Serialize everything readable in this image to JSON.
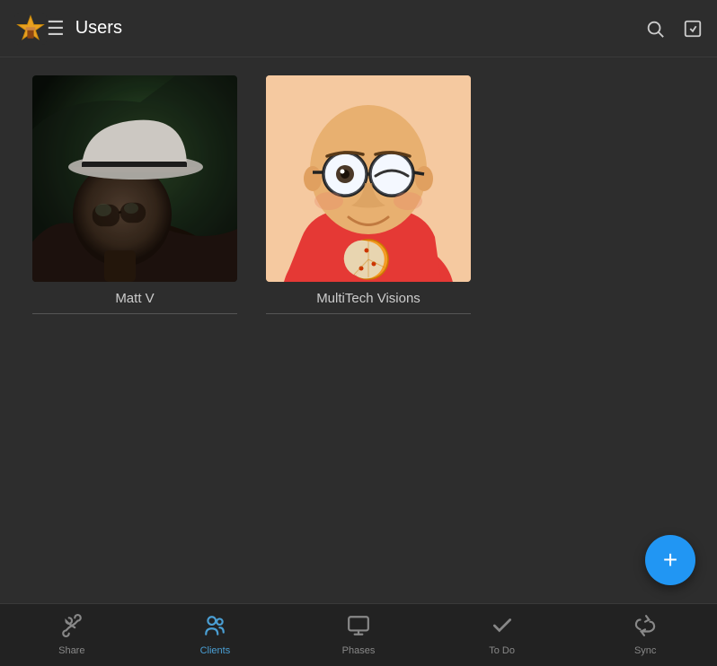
{
  "header": {
    "title": "Users",
    "menu_icon": "☰",
    "search_label": "search",
    "check_label": "check"
  },
  "users": [
    {
      "id": "matt-v",
      "name": "Matt V",
      "avatar_type": "photo"
    },
    {
      "id": "multitech-visions",
      "name": "MultiTech Visions",
      "avatar_type": "cartoon"
    }
  ],
  "fab": {
    "label": "+"
  },
  "nav": {
    "items": [
      {
        "id": "share",
        "label": "Share",
        "icon": "share",
        "active": false
      },
      {
        "id": "clients",
        "label": "Clients",
        "icon": "clients",
        "active": false
      },
      {
        "id": "phases",
        "label": "Phases",
        "icon": "phases",
        "active": false
      },
      {
        "id": "todo",
        "label": "To Do",
        "icon": "todo",
        "active": false
      },
      {
        "id": "sync",
        "label": "Sync",
        "icon": "sync",
        "active": false
      }
    ]
  }
}
